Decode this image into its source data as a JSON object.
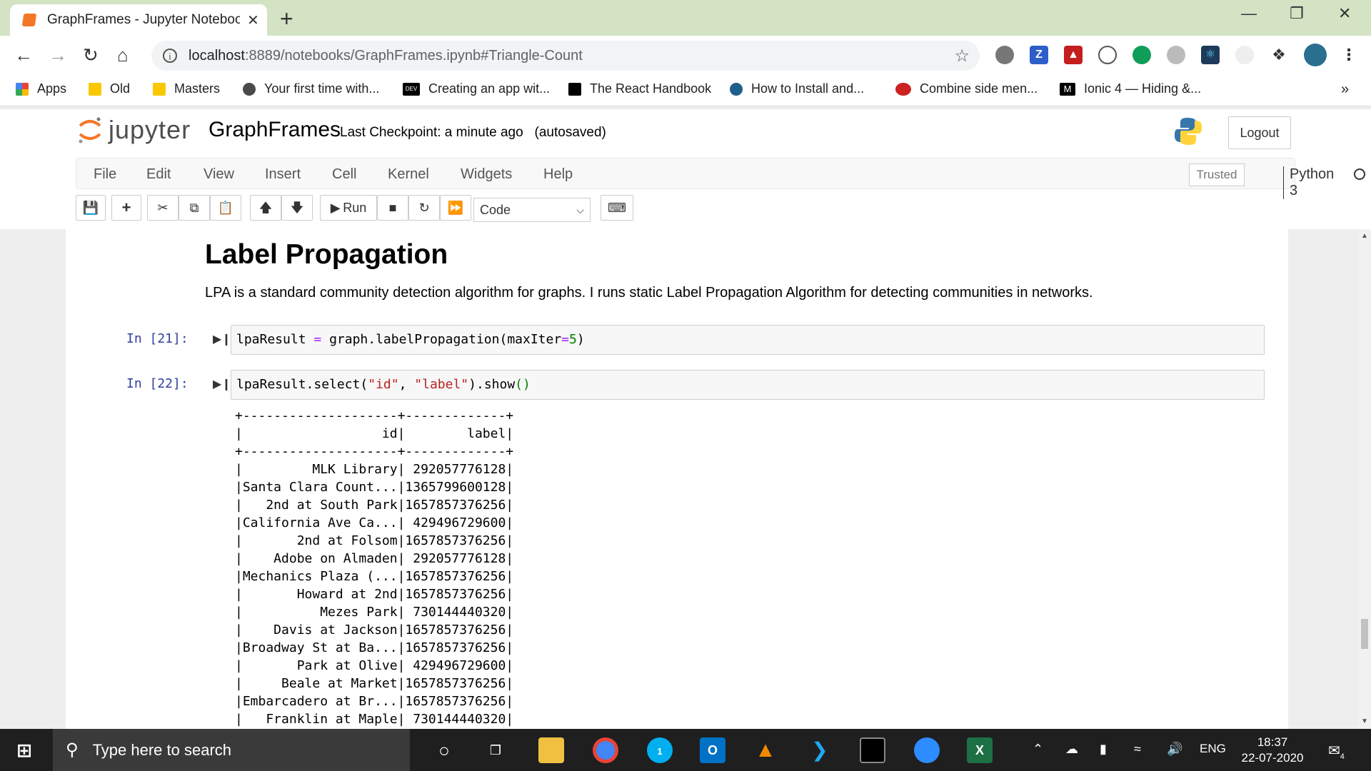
{
  "browser": {
    "tab_title": "GraphFrames - Jupyter Notebook",
    "tab_close": "✕",
    "new_tab": "+",
    "url_host": "localhost",
    "url_path": ":8889/notebooks/GraphFrames.ipynb#Triangle-Count",
    "bookmarks": [
      {
        "label": "Apps",
        "color": "#ea4335"
      },
      {
        "label": "Old",
        "color": "#f9c800"
      },
      {
        "label": "Masters",
        "color": "#f9c800"
      },
      {
        "label": "Your first time with...",
        "color": "#4a4a4a"
      },
      {
        "label": "Creating an app wit...",
        "color": "#000000"
      },
      {
        "label": "The React Handbook",
        "color": "#000000"
      },
      {
        "label": "How to Install and...",
        "color": "#1f5f8b"
      },
      {
        "label": "Combine side men...",
        "color": "#cc2222"
      },
      {
        "label": "Ionic 4 — Hiding &...",
        "color": "#000000"
      }
    ],
    "bookmarks_more": "»",
    "extension_letters": {
      "z": "Z",
      "dev": "DEV",
      "medium": "M"
    }
  },
  "jupyter": {
    "logo_text": "jupyter",
    "notebook_name": "GraphFrames",
    "checkpoint": "Last Checkpoint: a minute ago",
    "autosaved": "(autosaved)",
    "logout_label": "Logout",
    "menu": [
      "File",
      "Edit",
      "View",
      "Insert",
      "Cell",
      "Kernel",
      "Widgets",
      "Help"
    ],
    "trusted_label": "Trusted",
    "kernel_name": "Python 3",
    "toolbar": {
      "run_label": "Run",
      "cell_type": "Code"
    }
  },
  "notebook": {
    "md_title": "Label Propagation",
    "md_text": "LPA is a standard community detection algorithm for graphs. I runs static Label Propagation Algorithm for detecting communities in networks.",
    "cells": [
      {
        "prompt": "In [21]:",
        "code_parts": [
          "lpaResult",
          " = ",
          "graph.labelPropagation(",
          "maxIter",
          "=",
          "5",
          ")"
        ]
      },
      {
        "prompt": "In [22]:",
        "code_parts": [
          "lpaResult.select(",
          "\"id\"",
          ", ",
          "\"label\"",
          ").show",
          "()"
        ]
      }
    ],
    "output_lines": [
      "+--------------------+-------------+",
      "|                  id|        label|",
      "+--------------------+-------------+",
      "|         MLK Library| 292057776128|",
      "|Santa Clara Count...|1365799600128|",
      "|   2nd at South Park|1657857376256|",
      "|California Ave Ca...| 429496729600|",
      "|       2nd at Folsom|1657857376256|",
      "|    Adobe on Almaden| 292057776128|",
      "|Mechanics Plaza (...|1657857376256|",
      "|       Howard at 2nd|1657857376256|",
      "|          Mezes Park| 730144440320|",
      "|    Davis at Jackson|1657857376256|",
      "|Broadway St at Ba...|1657857376256|",
      "|       Park at Olive| 429496729600|",
      "|     Beale at Market|1657857376256|",
      "|Embarcadero at Br...|1657857376256|",
      "|   Franklin at Maple| 730144440320|"
    ]
  },
  "taskbar": {
    "search_placeholder": "Type here to search",
    "skype_badge": "1",
    "excel_letter": "X",
    "outlook_letter": "O",
    "lang": "ENG",
    "time": "18:37",
    "date": "22-07-2020",
    "notifications": "4"
  }
}
